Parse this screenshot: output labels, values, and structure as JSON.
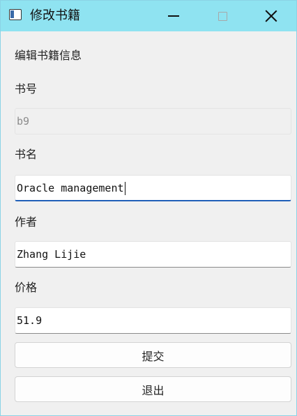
{
  "window": {
    "title": "修改书籍",
    "buttons": {
      "minimize": "minimize",
      "maximize": "maximize",
      "close": "close"
    }
  },
  "form": {
    "heading": "编辑书籍信息",
    "book_id": {
      "label": "书号",
      "value": "b9"
    },
    "book_name": {
      "label": "书名",
      "value": "Oracle management"
    },
    "author": {
      "label": "作者",
      "value": "Zhang Lijie"
    },
    "price": {
      "label": "价格",
      "value": "51.9"
    }
  },
  "actions": {
    "submit": "提交",
    "exit": "退出"
  },
  "colors": {
    "titlebar": "#8fe3f1",
    "window_bg": "#f0f0f0",
    "focus_accent": "#1f5fb8"
  }
}
